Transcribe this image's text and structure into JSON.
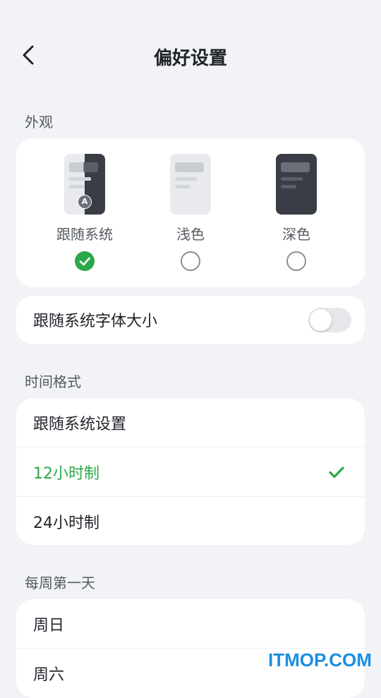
{
  "header": {
    "title": "偏好设置"
  },
  "appearance": {
    "section_label": "外观",
    "options": [
      {
        "label": "跟随系统",
        "selected": true,
        "badge": "A"
      },
      {
        "label": "浅色",
        "selected": false
      },
      {
        "label": "深色",
        "selected": false
      }
    ]
  },
  "font_follow": {
    "label": "跟随系统字体大小",
    "enabled": false
  },
  "time_format": {
    "section_label": "时间格式",
    "options": [
      {
        "label": "跟随系统设置",
        "selected": false
      },
      {
        "label": "12小时制",
        "selected": true
      },
      {
        "label": "24小时制",
        "selected": false
      }
    ]
  },
  "first_day": {
    "section_label": "每周第一天",
    "options": [
      {
        "label": "周日"
      },
      {
        "label": "周六"
      }
    ]
  },
  "watermark": "ITMOP.COM",
  "colors": {
    "accent": "#2ba84a",
    "background": "#f2f3f7",
    "dark_theme": "#3a3d45"
  }
}
